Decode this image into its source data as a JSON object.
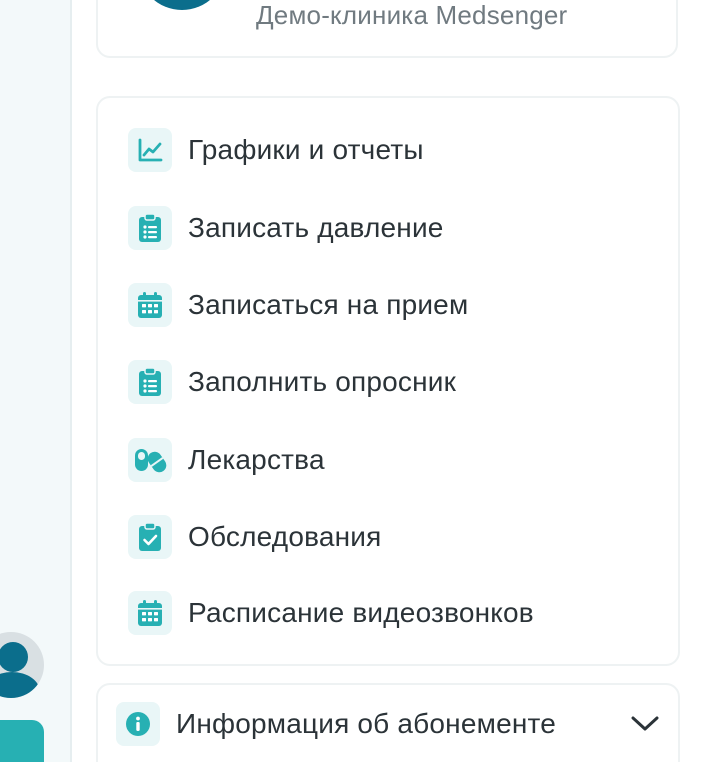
{
  "clinic": {
    "name": "Демо-клиника Medsenger"
  },
  "menu": {
    "items": [
      {
        "label": "Графики и отчеты",
        "icon": "chart-line-icon"
      },
      {
        "label": "Записать давление",
        "icon": "clipboard-list-icon"
      },
      {
        "label": "Записаться на прием",
        "icon": "calendar-icon"
      },
      {
        "label": "Заполнить опросник",
        "icon": "clipboard-list-icon"
      },
      {
        "label": "Лекарства",
        "icon": "pills-icon"
      },
      {
        "label": "Обследования",
        "icon": "clipboard-check-icon"
      },
      {
        "label": "Расписание видеозвонков",
        "icon": "calendar-icon"
      }
    ]
  },
  "info": {
    "label": "Информация об абонементе",
    "icon": "info-icon",
    "toggle_icon": "chevron-down-icon"
  },
  "colors": {
    "accent": "#27b0b3",
    "brand_dark": "#0b6e8c",
    "text": "#2b3338",
    "muted": "#707a80",
    "icon_bg": "#e9f6f7"
  }
}
